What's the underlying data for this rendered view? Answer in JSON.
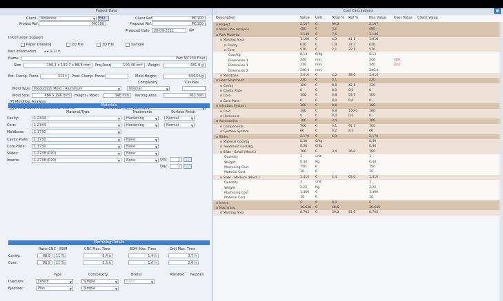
{
  "left": {
    "title": "Project Data",
    "client_label": "Client",
    "client_value": "Mollenne",
    "edit_btn": "Edit...",
    "client_ref_label": "Client Ref.",
    "client_ref_value": "MC100",
    "project_ref_label": "Project Ref.",
    "project_ref_value": "MC100",
    "proposal_ref_label": "Proposal Ref.",
    "proposal_ref_value": "MC100",
    "proposal_date_label": "Proposal Date",
    "proposal_date_value": "20-09-2011",
    "info_support_label": "Information Support",
    "paper_drawing": "Paper Drawing",
    "file_2d": "2D File",
    "file_3d": "3D File",
    "sample": "Sample",
    "part_info_label": "Part Information",
    "name_label": "Name",
    "name_value": "Part MC100 Final",
    "size_label": "Size",
    "size_value": "100,1 x 100,7 x 88,8  mm",
    "proj_area_label": "Proj.Area",
    "proj_area_value": "100,46  cm²",
    "weight_label": "Weight",
    "weight_value": "481 9 g",
    "est_clamp_label": "Est. Clamp. Force:",
    "est_clamp_value": "313 t",
    "prod_clamp_label": "Prod. Clamp. Force:",
    "prod_clamp_value": "",
    "mold_height_label": "Mold Height:",
    "mold_height_value": "344,5  kg",
    "complexity_label": "Complexity",
    "cavities_label": "Cavities",
    "mold_type_label": "Mold Type:",
    "mold_type_value": "Production Mold - Aluminum",
    "complexity_value": "Normal",
    "mold_size_label": "Mold Size:",
    "mold_size_value": "486 x 296  mm",
    "height_label": "Height / Mold:",
    "height_value": "346  mm",
    "parting_label": "Parting Area:",
    "parting_value": "361  mm",
    "moldflow_label": "Moldflow Analysis",
    "dim_label": "Dimensional Measurement Control",
    "standard_label": "Standards:",
    "standard_value": "By Hasco (Eco)",
    "materials_bar": "Materials",
    "material_type_hdr": "Material/Type",
    "treatment_hdr": "Treatments",
    "surface_hdr": "Surface Finish",
    "mat_rows": [
      {
        "label": "Cavity:",
        "value": "1.2344",
        "treat": "Hardening",
        "surf": "Normal"
      },
      {
        "label": "Core:",
        "value": "1.2344",
        "treat": "Hardening",
        "surf": "Normal"
      },
      {
        "label": "Moldbase:",
        "value": "1.1730",
        "treat": "",
        "surf": ""
      },
      {
        "label": "Cavity Plate:",
        "value": "1.1730",
        "treat": "None",
        "surf": ""
      },
      {
        "label": "Core Plate:",
        "value": "1.1730",
        "treat": "None",
        "surf": ""
      },
      {
        "label": "Slides:",
        "value": "1.2738 (P20)",
        "treat": "None",
        "surf": ""
      },
      {
        "label": "Inserts:",
        "value": "1.2738 (P20)",
        "treat": "None",
        "surf": ""
      }
    ],
    "qty_label": "Qty:",
    "qty_slides": "1",
    "qty_inserts": "1",
    "machining_bar": "Machining Details",
    "ratio_hdr": "Ratio CNC - EDM",
    "cnc_hdr": "CNC Mac. Time",
    "edm_hdr": "EDM Mac. Time",
    "drill_hdr": "Drill Mac. Time",
    "mach_rows": [
      {
        "label": "Cavity:",
        "r1": "88,9",
        "r2": "11 %",
        "cnc": "5,4 h",
        "edm": "1,4 h",
        "drill": "3,7 h"
      },
      {
        "label": "Core:",
        "r1": "88,9",
        "r2": "11 %",
        "cnc": "3,3 h",
        "edm": "1,6 h",
        "drill": "2,6 h"
      }
    ],
    "type_hdr": "Type",
    "complexity_hdr": "Complexity",
    "brand_hdr": "Brand",
    "manifold_hdr": "Manifold",
    "nozzles_hdr": "Nozzles",
    "inj_rows": [
      {
        "label": "Injection:",
        "type": "Direct",
        "cx": "Simple",
        "brand": "None"
      },
      {
        "label": "Ejection:",
        "type": "Pins",
        "cx": "Simple",
        "brand": ""
      }
    ]
  },
  "right": {
    "title": "Cost Calculations",
    "columns": [
      "Description",
      "Value",
      "Unit",
      "Total %",
      "Ref %",
      "Ncx Value",
      "User Value",
      "Client Value"
    ],
    "rows": [
      {
        "k": "grp",
        "d": "Project",
        "ind": 0,
        "v": "5.167",
        "u": "€",
        "t": "99,0",
        "r": "",
        "n": "5.167",
        "uv": ""
      },
      {
        "k": "grp",
        "d": "Mold Flow Analysis",
        "ind": 0,
        "v": "480",
        "u": "€",
        "t": "3,2",
        "r": "",
        "n": "480",
        "uv": ""
      },
      {
        "k": "grp",
        "d": "Raw Material",
        "ind": 0,
        "v": "1.148",
        "u": "€",
        "t": "7,6",
        "r": "",
        "n": "1.148",
        "uv": ""
      },
      {
        "k": "sub",
        "d": "Molding Area",
        "ind": 1,
        "v": "1.100",
        "u": "€",
        "t": "4,0",
        "r": "41,1",
        "n": "1.010",
        "uv": ""
      },
      {
        "k": "sub",
        "d": "Cavity",
        "ind": 2,
        "v": "616",
        "u": "€",
        "t": "1,9",
        "r": "37,7",
        "n": "616",
        "uv": ""
      },
      {
        "k": "sub",
        "d": "Core",
        "ind": 2,
        "v": "576",
        "u": "€",
        "t": "2,1",
        "r": "32,1",
        "n": "576",
        "uv": ""
      },
      {
        "k": "plain",
        "d": "Cost/Kg",
        "ind": 3,
        "v": "8,13",
        "u": "€/Kg",
        "t": "",
        "r": "",
        "n": "8,13",
        "uv": ""
      },
      {
        "k": "plain",
        "d": "Dimension 1",
        "ind": 3,
        "v": "240",
        "u": "mm",
        "t": "",
        "r": "",
        "n": "240",
        "uv": "120"
      },
      {
        "k": "plain",
        "d": "Dimension 1",
        "ind": 3,
        "v": "210",
        "u": "mm",
        "t": "",
        "r": "",
        "n": "240",
        "uv": "241"
      },
      {
        "k": "plain",
        "d": "Dimension 2",
        "ind": 3,
        "v": "240,4",
        "u": "mm",
        "t": "",
        "r": "",
        "n": "240,4",
        "uv": ""
      },
      {
        "k": "sub",
        "d": "Moldbase",
        "ind": 1,
        "v": "1.010",
        "u": "€",
        "t": "4,0",
        "r": "38,0",
        "n": "1.010",
        "uv": ""
      },
      {
        "k": "grp",
        "d": "Heat Treatment",
        "ind": 0,
        "v": "230",
        "u": "€",
        "t": "0,1",
        "r": "",
        "n": "230",
        "uv": ""
      },
      {
        "k": "sub",
        "d": "Cavity",
        "ind": 1,
        "v": "120",
        "u": "€",
        "t": "0,8",
        "r": "42,1",
        "n": "120",
        "uv": ""
      },
      {
        "k": "sub",
        "d": "Cavity Plate",
        "ind": 1,
        "v": "0",
        "u": "€",
        "t": "0,0",
        "r": "0,0",
        "n": "0",
        "uv": ""
      },
      {
        "k": "sub",
        "d": "Core",
        "ind": 1,
        "v": "100",
        "u": "€",
        "t": "0,8",
        "r": "53,7",
        "n": "100",
        "uv": ""
      },
      {
        "k": "sub",
        "d": "Core Plate",
        "ind": 1,
        "v": "0",
        "u": "€",
        "t": "0,0",
        "r": "0,0",
        "n": "0",
        "uv": ""
      },
      {
        "k": "grp",
        "d": "Injection System",
        "ind": 0,
        "v": "180",
        "u": "€",
        "t": "0,8",
        "r": "",
        "n": "180",
        "uv": ""
      },
      {
        "k": "sub",
        "d": "Cold",
        "ind": 1,
        "v": "180",
        "u": "€",
        "t": "0,8",
        "r": "100,0",
        "n": "180",
        "uv": ""
      },
      {
        "k": "sub",
        "d": "Hotrunner",
        "ind": 1,
        "v": "0",
        "u": "€",
        "t": "0,0",
        "r": "0,0",
        "n": "0",
        "uv": ""
      },
      {
        "k": "grp",
        "d": "Accessories",
        "ind": 0,
        "v": "766",
        "u": "€",
        "t": "3,4",
        "r": "",
        "n": "766",
        "uv": ""
      },
      {
        "k": "sub",
        "d": "Components",
        "ind": 1,
        "v": "700",
        "u": "€",
        "t": "3,1",
        "r": "91,7",
        "n": "700",
        "uv": ""
      },
      {
        "k": "sub",
        "d": "Ejection System",
        "ind": 1,
        "v": "66",
        "u": "€",
        "t": "0,2",
        "r": "8,3",
        "n": "66",
        "uv": ""
      },
      {
        "k": "grp",
        "d": "Slides",
        "ind": 0,
        "v": "2.170",
        "u": "€",
        "t": "6,9",
        "r": "",
        "n": "2.170",
        "uv": ""
      },
      {
        "k": "sub",
        "d": "Material Cost/Kg",
        "ind": 1,
        "v": "5,30",
        "u": "€/Kg",
        "t": "",
        "r": "",
        "n": "5,30",
        "uv": ""
      },
      {
        "k": "sub",
        "d": "Treatment Cost/Kg",
        "ind": 1,
        "v": "0,30",
        "u": "€/Kg",
        "t": "",
        "r": "",
        "n": "0,30",
        "uv": ""
      },
      {
        "k": "sub",
        "d": "Slide - Small (Mech.)",
        "ind": 1,
        "v": "760",
        "u": "€",
        "t": "3,4",
        "r": "36,0",
        "n": "760",
        "uv": ""
      },
      {
        "k": "plain",
        "d": "Quantity",
        "ind": 2,
        "v": "1",
        "u": "unit",
        "t": "",
        "r": "",
        "n": "1",
        "uv": ""
      },
      {
        "k": "plain",
        "d": "Weight",
        "ind": 2,
        "v": "0,44",
        "u": "Kg",
        "t": "",
        "r": "",
        "n": "0,44",
        "uv": ""
      },
      {
        "k": "plain",
        "d": "Machining Cost",
        "ind": 2,
        "v": "750",
        "u": "€",
        "t": "",
        "r": "",
        "n": "750",
        "uv": ""
      },
      {
        "k": "plain",
        "d": "Material Cost",
        "ind": 2,
        "v": "10",
        "u": "€",
        "t": "",
        "r": "",
        "n": "10",
        "uv": ""
      },
      {
        "k": "sub",
        "d": "Slide - Medium (Mech.)",
        "ind": 1,
        "v": "1.410",
        "u": "€",
        "t": "4,4",
        "r": "63,0",
        "n": "1.410",
        "uv": ""
      },
      {
        "k": "plain",
        "d": "Quantity",
        "ind": 2,
        "v": "1",
        "u": "unit",
        "t": "",
        "r": "",
        "n": "1",
        "uv": ""
      },
      {
        "k": "plain",
        "d": "Weight",
        "ind": 2,
        "v": "2,22",
        "u": "Kg",
        "t": "",
        "r": "",
        "n": "2,22",
        "uv": ""
      },
      {
        "k": "plain",
        "d": "Machining Cost",
        "ind": 2,
        "v": "1.400",
        "u": "€",
        "t": "",
        "r": "",
        "n": "1.400",
        "uv": ""
      },
      {
        "k": "plain",
        "d": "Material Cost",
        "ind": 2,
        "v": "10",
        "u": "€",
        "t": "",
        "r": "",
        "n": "10",
        "uv": ""
      },
      {
        "k": "grp",
        "d": "Insert",
        "ind": 0,
        "v": "0",
        "u": "€",
        "t": "0,0",
        "r": "",
        "n": "0",
        "uv": ""
      },
      {
        "k": "grp",
        "d": "Machining",
        "ind": 0,
        "v": "10.625",
        "u": "€",
        "t": "48,6",
        "r": "",
        "n": "10.625",
        "uv": ""
      },
      {
        "k": "sub",
        "d": "Molding Area",
        "ind": 1,
        "v": "8.705",
        "u": "€",
        "t": "39,0",
        "r": "81,9",
        "n": "8.705",
        "uv": ""
      }
    ]
  }
}
